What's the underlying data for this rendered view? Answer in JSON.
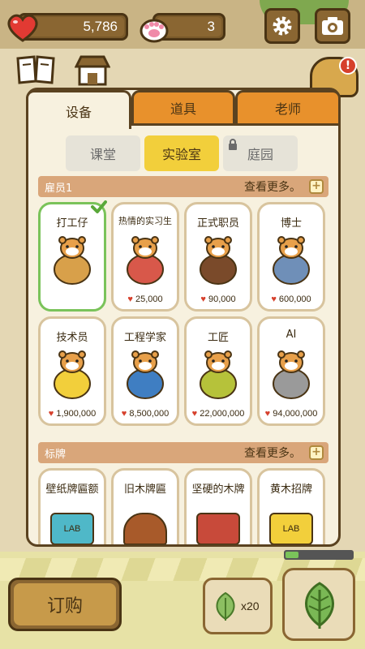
{
  "hud": {
    "hearts": "5,786",
    "paws": "3"
  },
  "tabs": [
    {
      "label": "设备",
      "active": true
    },
    {
      "label": "道具",
      "active": false
    },
    {
      "label": "老师",
      "active": false
    }
  ],
  "subtabs": [
    {
      "label": "课堂",
      "active": false,
      "locked": false
    },
    {
      "label": "实验室",
      "active": true,
      "locked": false
    },
    {
      "label": "庭园",
      "active": false,
      "locked": true
    }
  ],
  "section_staff": {
    "title": "雇员1",
    "more": "查看更多。",
    "plus": "+",
    "items": [
      {
        "name": "打工仔",
        "price": "",
        "selected": true,
        "body": "#d8a04a"
      },
      {
        "name": "热情的实习生",
        "price": "25,000",
        "selected": false,
        "body": "#d8584a"
      },
      {
        "name": "正式职员",
        "price": "90,000",
        "selected": false,
        "body": "#7a4a2a"
      },
      {
        "name": "博士",
        "price": "600,000",
        "selected": false,
        "body": "#6f8fb8"
      },
      {
        "name": "技术员",
        "price": "1,900,000",
        "selected": false,
        "body": "#f2cf3b"
      },
      {
        "name": "工程学家",
        "price": "8,500,000",
        "selected": false,
        "body": "#3f7ec2"
      },
      {
        "name": "工匠",
        "price": "22,000,000",
        "selected": false,
        "body": "#b6c23a"
      },
      {
        "name": "AI",
        "price": "94,000,000",
        "selected": false,
        "body": "#9a9a9a"
      }
    ]
  },
  "section_signs": {
    "title": "标牌",
    "more": "查看更多。",
    "plus": "+",
    "items": [
      {
        "name": "壁纸牌匾额",
        "sign_text": "LAB"
      },
      {
        "name": "旧木牌匾",
        "sign_text": ""
      },
      {
        "name": "坚硬的木牌",
        "sign_text": ""
      },
      {
        "name": "黄木招牌",
        "sign_text": "LAB"
      }
    ]
  },
  "bottom": {
    "order_label": "订购",
    "leaf_count": "x20",
    "progress": 0.2
  },
  "colors": {
    "tab_active": "#f7f1df",
    "tab_inactive": "#e8912c",
    "subtab_active": "#f2cf3b",
    "section_header": "#d9a67a",
    "selected_border": "#7ac35a",
    "heart": "#d6402c"
  }
}
